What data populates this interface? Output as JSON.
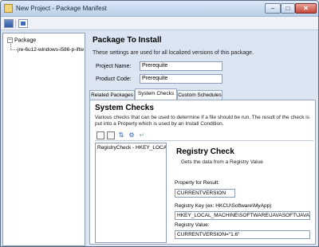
{
  "window": {
    "title": "New Project - Package Manifest",
    "min_glyph": "–",
    "max_glyph": "□",
    "close_glyph": "✕"
  },
  "toolbar": {
    "icons": [
      "save-icon",
      "package-icon"
    ]
  },
  "tree": {
    "root_toggle": "–",
    "root_label": "Package",
    "child_label": "jre-6u12-windows-i586-p-iftw"
  },
  "main": {
    "title": "Package To Install",
    "subtitle": "These settings are used for all localized versions of this package.",
    "project_name_label": "Project Name:",
    "project_name_value": "Prerequite",
    "product_code_label": "Product Code:",
    "product_code_value": "Prerequite"
  },
  "tabs": [
    {
      "label": "Related Packages",
      "active": false
    },
    {
      "label": "System Checks",
      "active": true
    },
    {
      "label": "Custom Schedules",
      "active": false
    }
  ],
  "system_checks": {
    "title": "System Checks",
    "description": "Various checks that can be used to determine if a file should be run. The result of the check is put into a Property which is used by an Install Condition.",
    "toolbar_icons": [
      "new-check-icon",
      "document-icon",
      "move-icon",
      "properties-icon",
      "disabled-icon"
    ],
    "list_items": [
      "RegistryCheck - HKEY_LOCAL_MACHINE\\SOFTWARE\\JAVASOFT"
    ],
    "detail": {
      "title": "Registry Check",
      "subtitle": "Gets the data from a Registry Value",
      "property_label": "Property for Result:",
      "property_value": "CURRENTVERSION",
      "key_label": "Registry Key (ex: HKCU\\Software\\MyApp)",
      "key_value": "HKEY_LOCAL_MACHINE\\SOFTWARE\\JAVASOFT\\JAVA R",
      "value_label": "Registry Value:",
      "value_value": "CURRENTVERSION=\"1.6\""
    }
  }
}
